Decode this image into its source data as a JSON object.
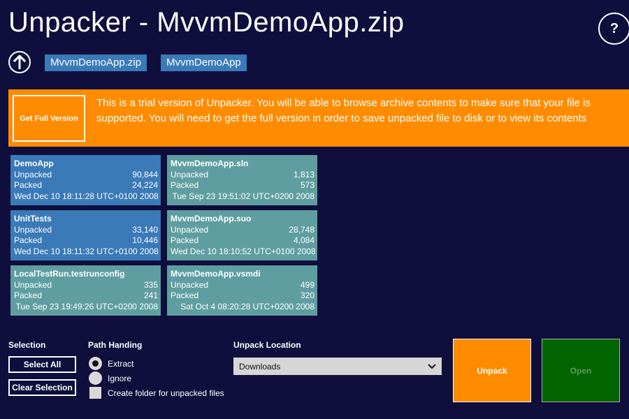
{
  "header": {
    "title": "Unpacker - MvvmDemoApp.zip",
    "help_label": "?",
    "breadcrumbs": [
      "MvvmDemoApp.zip",
      "MvvmDemoApp"
    ]
  },
  "trial": {
    "button_label": "Get Full Version",
    "message": "This is a trial version of Unpacker. You will be able to browse archive contents to make sure that your file is supported. You will need to get the full version in order to save unpacked file to disk or to view its contents"
  },
  "items": [
    {
      "name": "DemoApp",
      "unpacked_label": "Unpacked",
      "unpacked": "90,844",
      "packed_label": "Packed",
      "packed": "24,224",
      "date": "Wed Dec 10 18:11:28 UTC+0100 2008",
      "kind": "folder"
    },
    {
      "name": "MvvmDemoApp.sln",
      "unpacked_label": "Unpacked",
      "unpacked": "1,813",
      "packed_label": "Packed",
      "packed": "573",
      "date": "Tue Sep 23 19:51:02 UTC+0200 2008",
      "kind": "file"
    },
    {
      "name": "UnitTests",
      "unpacked_label": "Unpacked",
      "unpacked": "33,140",
      "packed_label": "Packed",
      "packed": "10,446",
      "date": "Wed Dec 10 18:11:32 UTC+0100 2008",
      "kind": "folder"
    },
    {
      "name": "MvvmDemoApp.suo",
      "unpacked_label": "Unpacked",
      "unpacked": "28,748",
      "packed_label": "Packed",
      "packed": "4,084",
      "date": "Wed Dec 10 18:10:52 UTC+0100 2008",
      "kind": "file"
    },
    {
      "name": "LocalTestRun.testrunconfig",
      "unpacked_label": "Unpacked",
      "unpacked": "335",
      "packed_label": "Packed",
      "packed": "241",
      "date": "Tue Sep 23 19:49:26 UTC+0200 2008",
      "kind": "file"
    },
    {
      "name": "MvvmDemoApp.vsmdi",
      "unpacked_label": "Unpacked",
      "unpacked": "499",
      "packed_label": "Packed",
      "packed": "320",
      "date": "Sat Oct 4 08:20:28 UTC+0200 2008",
      "kind": "file"
    }
  ],
  "selection": {
    "label": "Selection",
    "select_all": "Select All",
    "clear": "Clear Selection"
  },
  "path_handling": {
    "label": "Path Handing",
    "extract": "Extract",
    "ignore": "Ignore",
    "create_folder": "Create folder for unpacked files",
    "selected": "extract"
  },
  "location": {
    "label": "Unpack Location",
    "value": "Downloads"
  },
  "actions": {
    "unpack": "Unpack",
    "open": "Open"
  },
  "colors": {
    "background": "#0f0e3d",
    "accent": "#ff8c00",
    "folder_tile": "#3a7ab8",
    "file_tile": "#5f9ea0",
    "open_button": "#006400"
  }
}
